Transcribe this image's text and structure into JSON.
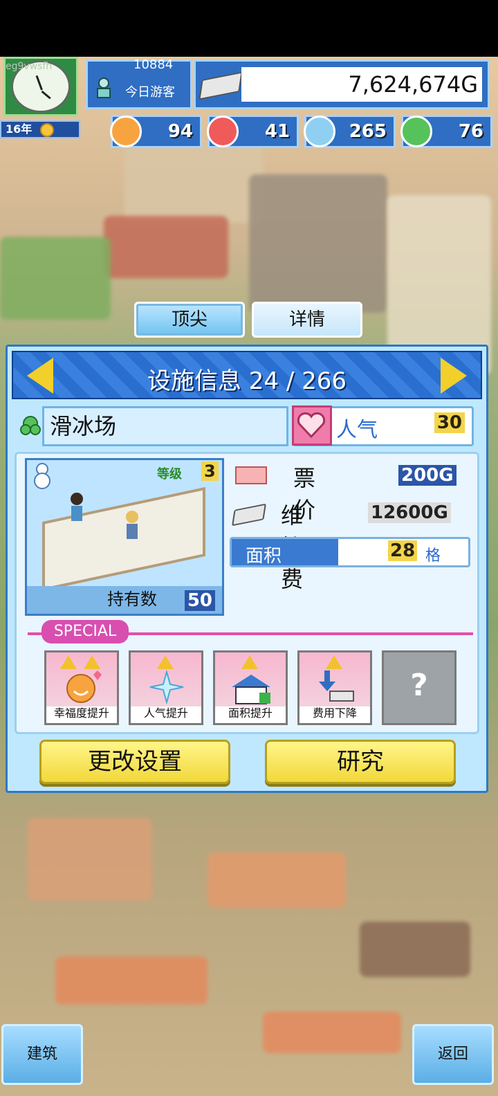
{
  "watermark": "eg9vwsfh",
  "hud": {
    "year": "16年",
    "visitors_count": "10884",
    "visitors_label": "今日游客",
    "money": "7,624,674G",
    "stats": [
      {
        "icon": "happy-face-icon",
        "value": "94",
        "color": "#f7a440"
      },
      {
        "icon": "fire-icon",
        "value": "41",
        "color": "#f05a5a"
      },
      {
        "icon": "water-drop-icon",
        "value": "265",
        "color": "#8fd0f2"
      },
      {
        "icon": "leaf-icon",
        "value": "76",
        "color": "#56c25a"
      }
    ]
  },
  "tabs": [
    {
      "label": "顶尖",
      "active": true
    },
    {
      "label": "详情",
      "active": false
    }
  ],
  "panel": {
    "title": "设施信息 24 / 266",
    "facility_name": "滑冰场",
    "popularity_label": "人气",
    "popularity_value": "30",
    "level_label": "等级",
    "level_value": "3",
    "owned_label": "持有数",
    "owned_value": "50",
    "ticket_label": "票价",
    "ticket_value": "200G",
    "maintenance_label": "维护费",
    "maintenance_value": "12600G",
    "area_label": "面积",
    "area_value": "28",
    "area_unit": "格",
    "special_label": "SPECIAL",
    "skills": [
      {
        "label": "幸福度提升",
        "stars": 2
      },
      {
        "label": "人气提升",
        "stars": 1
      },
      {
        "label": "面积提升",
        "stars": 1
      },
      {
        "label": "费用下降",
        "stars": 1
      }
    ],
    "locked_skill": "?",
    "change_settings_button": "更改设置",
    "research_button": "研究"
  },
  "bottom": {
    "build_button": "建筑",
    "back_button": "返回"
  }
}
